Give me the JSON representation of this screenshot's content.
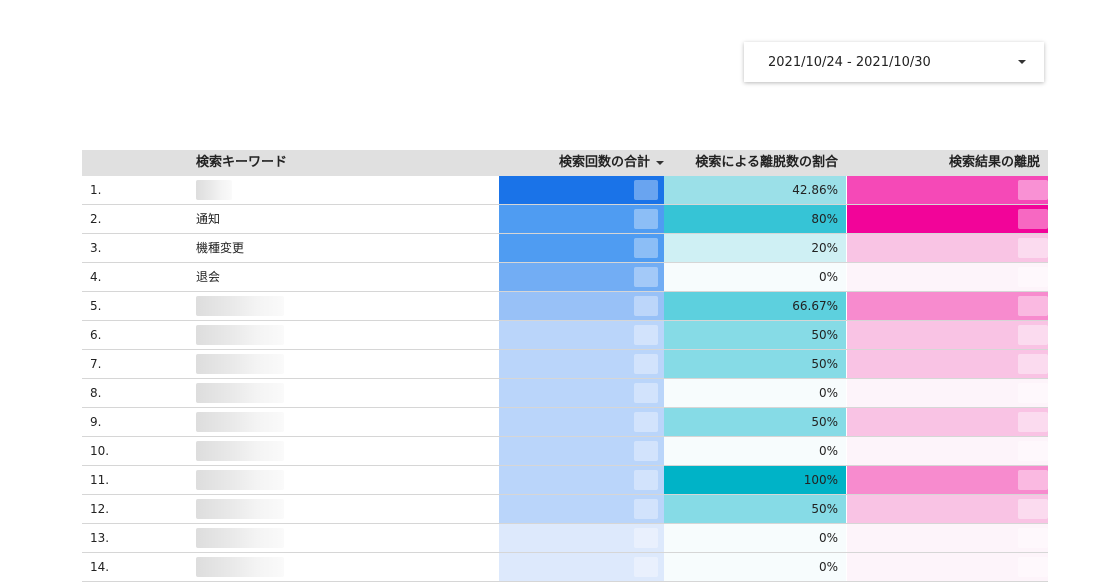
{
  "date_range": {
    "label": "2021/10/24 - 2021/10/30"
  },
  "table": {
    "headers": {
      "keyword": "検索キーワード",
      "count": "検索回数の合計",
      "exit_rate": "検索による離脱数の割合",
      "exits": "検索結果の離脱"
    },
    "sort": {
      "column": "count",
      "direction": "desc"
    },
    "rows": [
      {
        "index": "1.",
        "keyword": "",
        "count_color": "#1a73e8",
        "rate": "42.86%",
        "rate_color": "#9be0e8",
        "exit_color": "#f549b7"
      },
      {
        "index": "2.",
        "keyword": "通知",
        "count_color": "#4f9cf2",
        "rate": "80%",
        "rate_color": "#36c4d6",
        "exit_color": "#f20499"
      },
      {
        "index": "3.",
        "keyword": "機種変更",
        "count_color": "#4f9cf2",
        "rate": "20%",
        "rate_color": "#cff0f4",
        "exit_color": "#f9c4e4"
      },
      {
        "index": "4.",
        "keyword": "退会",
        "count_color": "#72adf4",
        "rate": "0%",
        "rate_color": "#f7fcfd",
        "exit_color": "#fdf4fa"
      },
      {
        "index": "5.",
        "keyword": "",
        "count_color": "#98c1f7",
        "rate": "66.67%",
        "rate_color": "#5dd0de",
        "exit_color": "#f78bce"
      },
      {
        "index": "6.",
        "keyword": "",
        "count_color": "#bad5fa",
        "rate": "50%",
        "rate_color": "#86dbe6",
        "exit_color": "#f9c3e4"
      },
      {
        "index": "7.",
        "keyword": "",
        "count_color": "#bad5fa",
        "rate": "50%",
        "rate_color": "#86dbe6",
        "exit_color": "#f9c3e4"
      },
      {
        "index": "8.",
        "keyword": "",
        "count_color": "#bad5fa",
        "rate": "0%",
        "rate_color": "#f7fcfd",
        "exit_color": "#fdf4fa"
      },
      {
        "index": "9.",
        "keyword": "",
        "count_color": "#bad5fa",
        "rate": "50%",
        "rate_color": "#86dbe6",
        "exit_color": "#f9c3e4"
      },
      {
        "index": "10.",
        "keyword": "",
        "count_color": "#bad5fa",
        "rate": "0%",
        "rate_color": "#f7fcfd",
        "exit_color": "#fdf4fa"
      },
      {
        "index": "11.",
        "keyword": "",
        "count_color": "#bad5fa",
        "rate": "100%",
        "rate_color": "#00b3c7",
        "exit_color": "#f78bce"
      },
      {
        "index": "12.",
        "keyword": "",
        "count_color": "#bad5fa",
        "rate": "50%",
        "rate_color": "#86dbe6",
        "exit_color": "#f9c3e4"
      },
      {
        "index": "13.",
        "keyword": "",
        "count_color": "#dde9fc",
        "rate": "0%",
        "rate_color": "#f7fcfd",
        "exit_color": "#fdf4fa"
      },
      {
        "index": "14.",
        "keyword": "",
        "count_color": "#dde9fc",
        "rate": "0%",
        "rate_color": "#f7fcfd",
        "exit_color": "#fdf4fa"
      }
    ]
  }
}
